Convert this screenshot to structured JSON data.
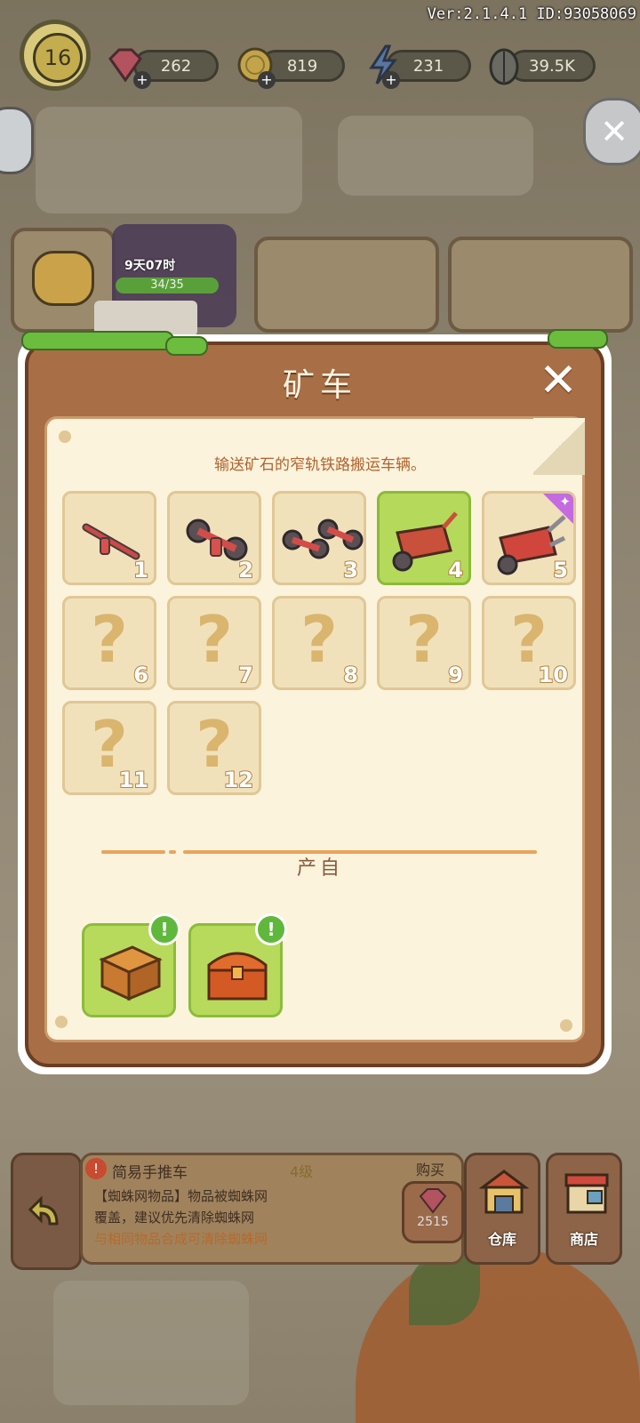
{
  "hud": {
    "version": "Ver:2.1.4.1 ID:93058069",
    "level": "16",
    "gems": "262",
    "coins": "819",
    "energy": "231",
    "seeds": "39.5K"
  },
  "event": {
    "timer": "9天07时",
    "progress": "34/35"
  },
  "dialog": {
    "title": "矿车",
    "description": "输送矿石的窄轨铁路搬运车辆。",
    "chain": [
      {
        "num": "1",
        "unlocked": true,
        "selected": false
      },
      {
        "num": "2",
        "unlocked": true,
        "selected": false
      },
      {
        "num": "3",
        "unlocked": true,
        "selected": false
      },
      {
        "num": "4",
        "unlocked": true,
        "selected": true
      },
      {
        "num": "5",
        "unlocked": true,
        "selected": false,
        "premium": true
      },
      {
        "num": "6",
        "unlocked": false,
        "placeholder": "?"
      },
      {
        "num": "7",
        "unlocked": false,
        "placeholder": "?"
      },
      {
        "num": "8",
        "unlocked": false,
        "placeholder": "?"
      },
      {
        "num": "9",
        "unlocked": false,
        "placeholder": "?"
      },
      {
        "num": "10",
        "unlocked": false,
        "placeholder": "?"
      },
      {
        "num": "11",
        "unlocked": false,
        "placeholder": "?"
      },
      {
        "num": "12",
        "unlocked": false,
        "placeholder": "?"
      }
    ],
    "source_label": "产自",
    "sources": [
      "wooden-chest",
      "orange-chest"
    ],
    "badge_mark": "!"
  },
  "info_panel": {
    "icon_mark": "!",
    "item_name": "简易手推车",
    "item_level": "4级",
    "line1": "【蜘蛛网物品】物品被蜘蛛网",
    "line2": "覆盖，建议优先清除蜘蛛网",
    "line3": "与相同物品合成可清除蜘蛛网",
    "buy_label": "购买",
    "buy_price": "2515"
  },
  "bottom_buttons": {
    "warehouse": "仓库",
    "shop": "商店"
  },
  "colors": {
    "dialog_brown": "#a86e45",
    "paper": "#fbf3dc",
    "selected_slot": "#b5d95a",
    "description_text": "#b3612d"
  }
}
